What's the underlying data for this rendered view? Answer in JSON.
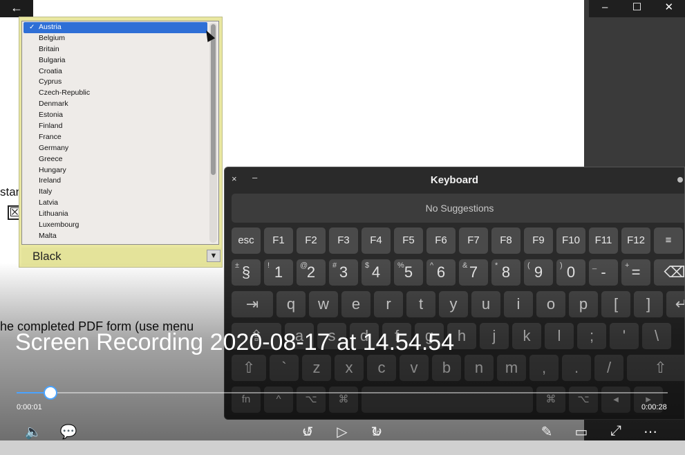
{
  "window": {
    "back_icon": "arrow-left-icon",
    "controls": [
      "–",
      "☐",
      "✕"
    ]
  },
  "document": {
    "text_fragment_1": "stan",
    "checkbox_mark": "☒",
    "text_fragment_2": "he completed PDF form (use menu"
  },
  "dropdown": {
    "items": [
      "Austria",
      "Belgium",
      "Britain",
      "Bulgaria",
      "Croatia",
      "Cyprus",
      "Czech-Republic",
      "Denmark",
      "Estonia",
      "Finland",
      "France",
      "Germany",
      "Greece",
      "Hungary",
      "Ireland",
      "Italy",
      "Latvia",
      "Lithuania",
      "Luxembourg",
      "Malta"
    ],
    "selected": "Austria",
    "check_mark": "✓",
    "color_value": "Black",
    "arrow": "▼"
  },
  "keyboard": {
    "title": "Keyboard",
    "suggestions": "No Suggestions",
    "close": "×",
    "minimize": "–",
    "row_fn": [
      "esc",
      "F1",
      "F2",
      "F3",
      "F4",
      "F5",
      "F6",
      "F7",
      "F8",
      "F9",
      "F10",
      "F11",
      "F12",
      "≡"
    ],
    "row_num": [
      "§",
      "1",
      "2",
      "3",
      "4",
      "5",
      "6",
      "7",
      "8",
      "9",
      "0",
      "-",
      "=",
      "⌫"
    ],
    "row_num_shift": [
      "±",
      "!",
      "@",
      "#",
      "$",
      "%",
      "^",
      "&",
      "*",
      "(",
      ")",
      "_",
      "+",
      ""
    ],
    "row_q": [
      "⇥",
      "q",
      "w",
      "e",
      "r",
      "t",
      "y",
      "u",
      "i",
      "o",
      "p",
      "[",
      "]",
      "↵"
    ],
    "row_a": [
      "⇪",
      "a",
      "s",
      "d",
      "f",
      "g",
      "h",
      "j",
      "k",
      "l",
      ";",
      "'",
      "\\"
    ],
    "row_z": [
      "⇧",
      "`",
      "z",
      "x",
      "c",
      "v",
      "b",
      "n",
      "m",
      ",",
      ".",
      "/",
      "⇧"
    ],
    "row_bottom": [
      "fn",
      "^",
      "⌥",
      "⌘",
      "",
      "⌘",
      "⌥",
      "◂",
      "▸"
    ]
  },
  "player": {
    "title": "Screen Recording 2020-08-17 at 14.54.54",
    "time_elapsed": "0:00:01",
    "time_remaining": "0:00:28",
    "progress_fraction": 0.052,
    "controls": {
      "volume_icon": "🔈",
      "captions_icon": "💬",
      "rewind_label": "10",
      "forward_label": "30",
      "play_icon": "▷",
      "pen_icon": "✎",
      "miniview_icon": "▭",
      "fullscreen_icon": "⤢",
      "more_icon": "⋯"
    }
  },
  "colors": {
    "accent": "#4aa3ff",
    "selection": "#2f6fd6",
    "form_field": "#e4e39a"
  }
}
